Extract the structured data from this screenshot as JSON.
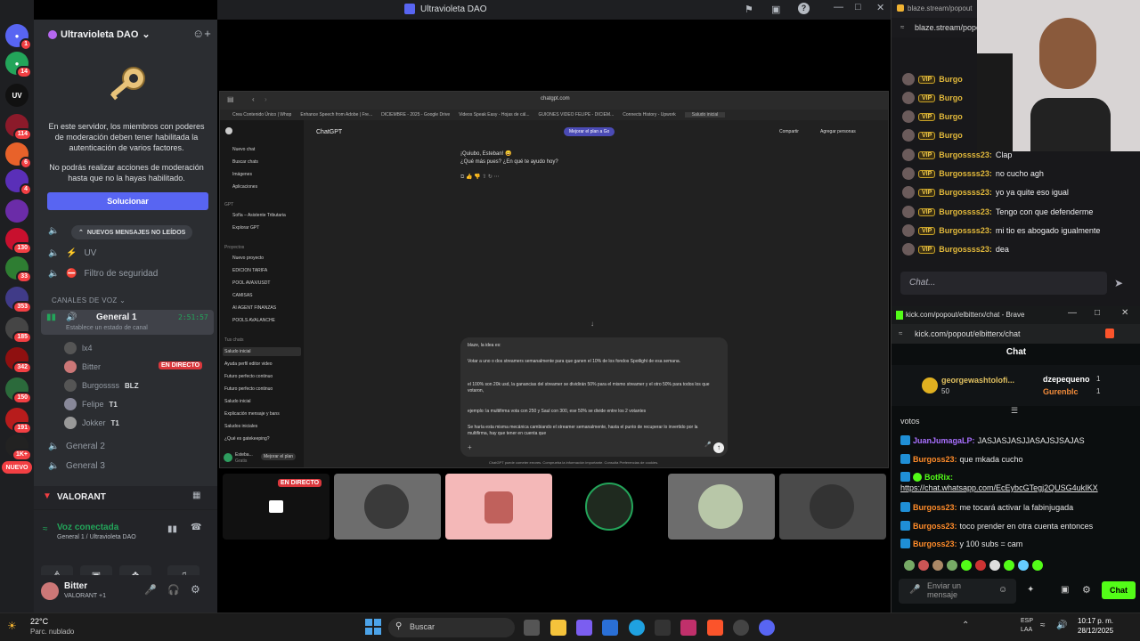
{
  "window": {
    "title": "Ultravioleta DAO"
  },
  "rail": {
    "servers": [
      {
        "label": "",
        "badge": "1"
      },
      {
        "label": "",
        "badge": "14"
      },
      {
        "label": "UV",
        "badge": ""
      },
      {
        "label": "",
        "badge": "114"
      },
      {
        "label": "",
        "badge": "6"
      },
      {
        "label": "",
        "badge": "4"
      },
      {
        "label": "",
        "badge": ""
      },
      {
        "label": "",
        "badge": "130"
      },
      {
        "label": "",
        "badge": "33"
      },
      {
        "label": "",
        "badge": "353"
      },
      {
        "label": "",
        "badge": "185"
      },
      {
        "label": "",
        "badge": "342"
      },
      {
        "label": "",
        "badge": "150"
      },
      {
        "label": "",
        "badge": "191"
      },
      {
        "label": "",
        "badge": "1K+"
      },
      {
        "label": "",
        "badge": "1K+"
      }
    ],
    "new_label": "NUEVO"
  },
  "sidebar": {
    "server_name": "Ultravioleta DAO",
    "mfa_text_1": "En este servidor, los miembros con poderes de moderación deben tener habilitada la autenticación de varios factores.",
    "mfa_text_2": "No podrás realizar acciones de moderación hasta que no la hayas habilitado.",
    "solve_label": "Solucionar",
    "new_messages": "NUEVOS MENSAJES NO LEÍDOS",
    "channels": [
      {
        "name": "UV"
      },
      {
        "name": "Filtro de seguridad"
      }
    ],
    "voice_category": "CANALES DE VOZ",
    "general1": {
      "name": "General 1",
      "timer": "2:51:57",
      "status": "Establece un estado de canal"
    },
    "members": [
      {
        "name": "lx4",
        "tag": ""
      },
      {
        "name": "Bitter",
        "tag": ""
      },
      {
        "name": "Burgossss",
        "tag": "BLZ"
      },
      {
        "name": "Felipe",
        "tag": "T1"
      },
      {
        "name": "Jokker",
        "tag": "T1"
      }
    ],
    "live_label": "EN DIRECTO",
    "other_channels": [
      {
        "name": "General 2"
      },
      {
        "name": "General 3"
      }
    ],
    "game": "VALORANT",
    "voice_connected": "Voz conectada",
    "voice_channel": "General 1 / Ultravioleta DAO",
    "user": {
      "name": "Bitter",
      "status": "VALORANT +1"
    }
  },
  "browser": {
    "url": "chatgpt.com",
    "bookmarks": [
      "Crea Contenido Único | Whop",
      "Enhance Speech from Adobe | Fre...",
      "DICIEMBRE - 2025 - Google Drive",
      "Videos Speak Easy - Hojas de cál...",
      "GUIONES VIDEO FELIPE - DICIEM...",
      "Connects History - Upwork",
      "Saludo inicial"
    ],
    "app_title": "ChatGPT",
    "upgrade": "Mejorar el plan a Go",
    "share": "Compartir",
    "add_people": "Agregar personas",
    "nav": [
      "Nuevo chat",
      "Buscar chats",
      "Imágenes",
      "Aplicaciones"
    ],
    "gpt_header": "GPT",
    "gpts": [
      "Sofía – Asistente Tributaria",
      "Explorar GPT"
    ],
    "projects_header": "Proyectos",
    "projects": [
      "Nuevo proyecto",
      "EDICION TARIFA",
      "POOL AVAX/USDT",
      "CAMISAS",
      "AI AGENT FINANZAS",
      "POOLS AVALANCHE"
    ],
    "chats_header": "Tus chats",
    "chats": [
      "Saludo inicial",
      "Ayuda perfil editor video",
      "Futuro perfecto continuo",
      "Futuro perfecto continuo",
      "Saludo inicial",
      "Explicación mensaje y bans",
      "Saludos iniciales",
      "¿Qué es gatekeeping?"
    ],
    "user_name": "Esteba...",
    "user_plan": "Gratis",
    "upgrade_small": "Mejorar el plan",
    "assistant_1": "¡Quiubo, Esteban! 😄",
    "assistant_2": "¿Qué más pues? ¿En qué te ayudo hoy?",
    "draft": [
      "blaze, la idea es:",
      "Votar a uno o dos streamers semanalmente para que ganen el 10% de los fondos Spotlight de esa semana.",
      "el 100% son 20k usd, la ganancias del streamer se dividirán 50% para el mismo streamer y el otro 50% para todos los que votaron,",
      "ejemplo: la multifirma vota con 250 y Saul con 300, ese 50% se divide entre los 2 votantes",
      "Se haría esta misma mecánica cambiando el streamer semanalmente, hasta el punto de recuperar lo invertido por la multifirma, hay que tener en cuenta que"
    ],
    "disclaimer": "ChatGPT puede cometer errores. Comprueba la información importante. Consulta Preferencias de cookies."
  },
  "tiles": {
    "live_label": "EN DIRECTO"
  },
  "blaze": {
    "tab_title": "blaze.stream/popout",
    "url": "blaze.stream/popout",
    "messages": [
      {
        "user": "Burgo",
        "text": ""
      },
      {
        "user": "Burgo",
        "text": ""
      },
      {
        "user": "Burgo",
        "text": ""
      },
      {
        "user": "Burgo",
        "text": ""
      },
      {
        "user": "Burgossss23:",
        "text": "Clap"
      },
      {
        "user": "Burgossss23:",
        "text": "no cucho agh"
      },
      {
        "user": "Burgossss23:",
        "text": "yo ya quite eso igual"
      },
      {
        "user": "Burgossss23:",
        "text": "Tengo con que defenderme"
      },
      {
        "user": "Burgossss23:",
        "text": "mi tio es abogado igualmente"
      },
      {
        "user": "Burgossss23:",
        "text": "dea"
      }
    ],
    "vip": "VIP",
    "chat_placeholder": "Chat..."
  },
  "kick": {
    "title": "kick.com/popout/elbitterx/chat - Brave",
    "url": "kick.com/popout/elbitterx/chat",
    "header": "Chat",
    "gifter": {
      "name": "georgewashtolofi...",
      "count": "50"
    },
    "top": [
      {
        "name": "dzepequeno",
        "count": "1"
      },
      {
        "name": "Gurenblc",
        "count": "1"
      }
    ],
    "pinned": "votos",
    "messages": [
      {
        "user": "JuanJumagaLP:",
        "text": "JASJASJASJJASAJSJSAJAS",
        "color": "#a970ff"
      },
      {
        "user": "Burgoss23:",
        "text": "que mkada cucho",
        "color": "#ff8c2a"
      },
      {
        "user": "BotRix:",
        "text": "",
        "color": "#53fc18"
      },
      {
        "user": "",
        "text": "https://chat.whatsapp.com/EcEybcGTegj2QUSG4ukIKX",
        "color": "#ffffff"
      },
      {
        "user": "Burgoss23:",
        "text": "me tocará activar la fabinjugada",
        "color": "#ff8c2a"
      },
      {
        "user": "Burgoss23:",
        "text": "toco prender en otra cuenta entonces",
        "color": "#ff8c2a"
      },
      {
        "user": "Burgoss23:",
        "text": "y 100 subs = cam",
        "color": "#ff8c2a"
      }
    ],
    "input_placeholder": "Enviar un mensaje",
    "chat_button": "Chat"
  },
  "taskbar": {
    "weather_temp": "22°C",
    "weather_desc": "Parc. nublado",
    "search": "Buscar",
    "lang": "ESP",
    "lang2": "LAA",
    "time": "10:17 p. m.",
    "date": "28/12/2025"
  }
}
